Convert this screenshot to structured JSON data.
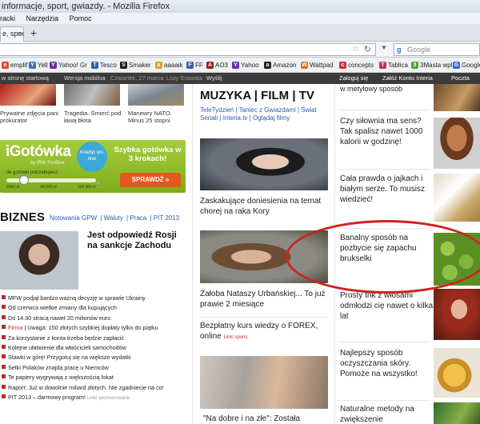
{
  "window": {
    "title": "informacje, sport, gwiazdy. - Mozilla Firefox"
  },
  "menu": [
    "racki",
    "Narzędzia",
    "Pomoc"
  ],
  "tab": {
    "label": "e, spor...",
    "close": "×"
  },
  "new_tab": "+",
  "search": {
    "placeholder": "Google",
    "engine_glyph": "g"
  },
  "bookmarks": [
    "emplif",
    "Yell",
    "Yahoo! Gr",
    "Tesco",
    "Smaker",
    "aaaaik",
    "FF",
    "AO3",
    "Yahoo",
    "Amazon",
    "Wattpad",
    "concepts",
    "Tablica",
    "3Masta wpl",
    "Google"
  ],
  "sitebar": {
    "home": "w stronę startową",
    "mobile": "Wersja mobilna",
    "date": "Czwartek, 27 marca",
    "weather": "Listy Erawata",
    "search": "Wyślij",
    "login": "Zaloguj się",
    "register": "Załóż Konto Interia",
    "mail": "Poczta"
  },
  "top_captions": [
    "Prywatne zdjęcia pani prokurator",
    "Tragedia. Śmierć pod ławą błota",
    "Manewry NATO. Minus 25 stopni"
  ],
  "igotowka": {
    "logo": "iGotówka",
    "sub": "by IRW PortBox",
    "bubble": "Kredyt on-line",
    "fast": "Szybka gotówka w 3 krokach!",
    "label": "Ile gotówki potrzebujesz:",
    "scale": [
      "2000 zł",
      "40 000 zł",
      "120 000 zł"
    ],
    "button": "SPRAWDŹ »",
    "slider_fraction": 0.2
  },
  "biznes": {
    "title": "BIZNES",
    "links": [
      "Notowania GPW",
      "Waluty",
      "Praca",
      "PIT 2013"
    ],
    "lead_title": "Jest odpowiedź Rosji na sankcje Zachodu",
    "news": [
      {
        "text": "MFW podjął bardzo ważną decyzję w sprawie Ukrainy",
        "tag": ""
      },
      {
        "text": "Od czerwca wielkie zmiany dla kupujących",
        "tag": ""
      },
      {
        "text": "Do 14.30 stracą nawet 20 milionów euro",
        "tag": ""
      },
      {
        "text": "Uwaga: 150 złotych szybkiej dopłaty tylko do piątku",
        "tag": "Firma"
      },
      {
        "text": "Za korzystanie z konta trzeba będzie zapłacić",
        "tag": ""
      },
      {
        "text": "Kolejne ułatwienie dla właścicieli samochodów",
        "tag": ""
      },
      {
        "text": "Stawki w górę! Przygotuj się na większe wydatki",
        "tag": ""
      },
      {
        "text": "Setki Polaków znajdą pracę u Niemców",
        "tag": ""
      },
      {
        "text": "Te papiery wygrywają z większością lokat",
        "tag": ""
      },
      {
        "text": "Raport: Już w dowolnie miliard złotych. Nie zgadniecie na co!",
        "tag": ""
      },
      {
        "text": "PIT 2013 – darmowy program!",
        "tag": "",
        "spons": "Linki sponsorowane"
      }
    ]
  },
  "muzyka": {
    "title": "MUZYKA",
    "title2": "FILM",
    "title3": "TV",
    "links": "TeleTydzień | Taniec z Gwiazdami | Świat Seriali | Interia.tv | Oglądaj filmy",
    "head1": "Zaskakujące doniesienia na temat chorej na raka Kory",
    "head2": "Żałoba Nataszy Urbańskiej... To już prawie 2 miesiące",
    "head3": "Bezpłatny kurs wiedzy o FOREX, online",
    "head3_spons": "Linki spons",
    "head4": "\"Na dobre i na złe\": Została"
  },
  "ads": [
    {
      "text": "w metylowy sposób"
    },
    {
      "text": "Czy siłownia ma sens? Tak spalisz nawet 1000 kalorii w godzinę!"
    },
    {
      "text": "Cała prawda o jajkach i białym serze. To musisz wiedzieć!"
    },
    {
      "text": "Banalny sposób na pozbycie się zapachu brukselki"
    },
    {
      "text": "Prosty trik z włosami odmłodzi cię nawet o kilka lat"
    },
    {
      "text": "Najlepszy sposób oczyszczania skóry. Pomoże na wszystko!"
    },
    {
      "text": "Naturalne metody na zwiększenie"
    }
  ]
}
